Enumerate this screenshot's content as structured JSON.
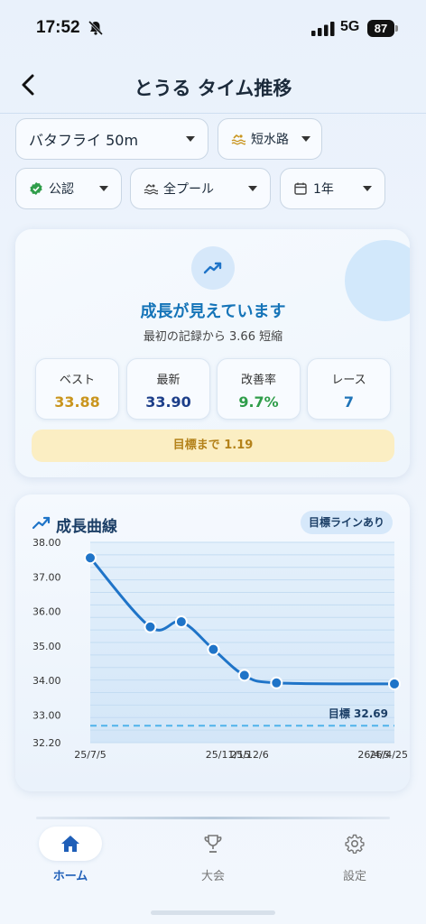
{
  "status": {
    "time": "17:52",
    "network": "5G",
    "battery": "87"
  },
  "nav": {
    "title": "とうる タイム推移"
  },
  "filters": {
    "event": "バタフライ 50m",
    "course": "短水路",
    "official": "公認",
    "pool": "全プール",
    "period": "1年"
  },
  "summary": {
    "headline": "成長が見えています",
    "subline": "最初の記録から 3.66 短縮",
    "stats": [
      {
        "label": "ベスト",
        "value": "33.88",
        "color": "#c9951e"
      },
      {
        "label": "最新",
        "value": "33.90",
        "color": "#1d3f8a"
      },
      {
        "label": "改善率",
        "value": "9.7%",
        "color": "#2f9d4a"
      },
      {
        "label": "レース",
        "value": "7",
        "color": "#1f74b8"
      }
    ],
    "goal_text": "目標まで 1.19"
  },
  "chart_header": {
    "title": "成長曲線",
    "tag": "目標ラインあり"
  },
  "chart_data": {
    "type": "line",
    "title": "成長曲線",
    "xlabel": "",
    "ylabel": "",
    "ylim": [
      32.2,
      38.0
    ],
    "y_ticks": [
      "38.00",
      "37.00",
      "36.00",
      "35.00",
      "34.00",
      "33.00",
      "32.20"
    ],
    "y_tick_values": [
      38.0,
      37.0,
      36.0,
      35.0,
      34.0,
      33.0,
      32.2
    ],
    "x_tick_labels": [
      "25/7/5",
      "25/11/15",
      "25/12/6",
      "26/4/5",
      "26/4/25"
    ],
    "x_tick_dates": [
      "2025-07-05",
      "2025-11-15",
      "2025-12-06",
      "2026-04-05",
      "2026-04-25"
    ],
    "x_range": [
      "2025-07-05",
      "2026-04-25"
    ],
    "series": [
      {
        "dates": [
          "2025-07-05",
          "2025-09-01",
          "2025-10-01",
          "2025-11-01",
          "2025-12-01",
          "2026-01-01",
          "2026-04-25"
        ],
        "values": [
          37.55,
          35.55,
          35.7,
          34.9,
          34.15,
          33.93,
          33.9
        ],
        "color": "#1f74c8"
      }
    ],
    "goal": {
      "value": 32.69,
      "label": "目標 32.69",
      "color": "#4fb3ea"
    },
    "grid": true
  },
  "tabs": [
    {
      "label": "ホーム",
      "icon": "home-icon",
      "active": true
    },
    {
      "label": "大会",
      "icon": "trophy-icon",
      "active": false
    },
    {
      "label": "設定",
      "icon": "gear-icon",
      "active": false
    }
  ],
  "colors": {
    "accent": "#1f74c8",
    "primary_text": "#1b2a3a",
    "goal_bg": "#fbeec3"
  }
}
